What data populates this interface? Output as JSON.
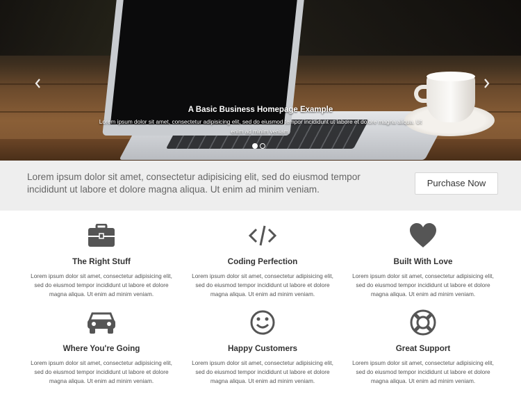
{
  "hero": {
    "title": "A Basic Business Homepage Example",
    "text": "Lorem ipsum dolor sit amet, consectetur adipisicing elit, sed do eiusmod tempor incididunt ut labore et dolore magna aliqua. Ut enim ad minim veniam.",
    "prev_icon": "chevron-left-icon",
    "next_icon": "chevron-right-icon",
    "slides_count": 2,
    "active_slide": 1
  },
  "cta": {
    "text": "Lorem ipsum dolor sit amet, consectetur adipisicing elit, sed do eiusmod tempor incididunt ut labore et dolore magna aliqua. Ut enim ad minim veniam.",
    "button_label": "Purchase Now"
  },
  "features": [
    {
      "icon": "briefcase-icon",
      "title": "The Right Stuff",
      "text": "Lorem ipsum dolor sit amet, consectetur adipisicing elit, sed do eiusmod tempor incididunt ut labore et dolore magna aliqua. Ut enim ad minim veniam."
    },
    {
      "icon": "code-icon",
      "title": "Coding Perfection",
      "text": "Lorem ipsum dolor sit amet, consectetur adipisicing elit, sed do eiusmod tempor incididunt ut labore et dolore magna aliqua. Ut enim ad minim veniam."
    },
    {
      "icon": "heart-icon",
      "title": "Built With Love",
      "text": "Lorem ipsum dolor sit amet, consectetur adipisicing elit, sed do eiusmod tempor incididunt ut labore et dolore magna aliqua. Ut enim ad minim veniam."
    },
    {
      "icon": "car-icon",
      "title": "Where You're Going",
      "text": "Lorem ipsum dolor sit amet, consectetur adipisicing elit, sed do eiusmod tempor incididunt ut labore et dolore magna aliqua. Ut enim ad minim veniam."
    },
    {
      "icon": "smile-icon",
      "title": "Happy Customers",
      "text": "Lorem ipsum dolor sit amet, consectetur adipisicing elit, sed do eiusmod tempor incididunt ut labore et dolore magna aliqua. Ut enim ad minim veniam."
    },
    {
      "icon": "life-ring-icon",
      "title": "Great Support",
      "text": "Lorem ipsum dolor sit amet, consectetur adipisicing elit, sed do eiusmod tempor incididunt ut labore et dolore magna aliqua. Ut enim ad minim veniam."
    }
  ],
  "colors": {
    "icon": "#555555",
    "cta_band": "#eeeeee",
    "heading": "#333333"
  }
}
